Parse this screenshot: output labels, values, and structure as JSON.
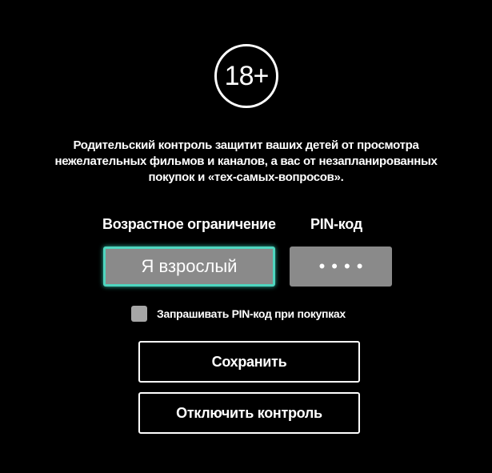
{
  "badge": {
    "text": "18+"
  },
  "description": {
    "lines": [
      "Родительский контроль защитит ваших детей от просмотра",
      "нежелательных фильмов и каналов, а вас от незапланированных",
      "покупок и «тех-самых-вопросов»."
    ]
  },
  "age_restriction": {
    "label": "Возрастное ограничение",
    "value": "Я взрослый"
  },
  "pin": {
    "label": "PIN-код",
    "masked_value": "••••"
  },
  "purchase_checkbox": {
    "label": "Запрашивать PIN-код при покупках",
    "checked": false
  },
  "buttons": {
    "save": "Сохранить",
    "disable": "Отключить контроль"
  },
  "colors": {
    "background": "#000000",
    "focus_accent": "#4fd6bf",
    "field_fill": "#8a8a8a"
  }
}
